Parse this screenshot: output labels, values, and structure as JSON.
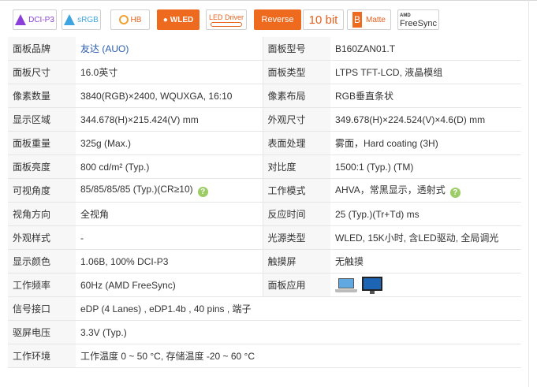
{
  "badges": {
    "dcip3": "DCI-P3",
    "srgb": "sRGB",
    "hb": "HB",
    "wled": "WLED",
    "led_driver": "LED Driver",
    "reverse": "Reverse",
    "bit": "10 bit",
    "matte_letter": "B",
    "matte": "Matte",
    "amd_small": "AMD",
    "freesync": "FreeSync"
  },
  "rows": [
    {
      "l1": "面板品牌",
      "v1": "友达 (AUO)",
      "l2": "面板型号",
      "v2": "B160ZAN01.T"
    },
    {
      "l1": "面板尺寸",
      "v1": "16.0英寸",
      "l2": "面板类型",
      "v2": "LTPS TFT-LCD, 液晶模组"
    },
    {
      "l1": "像素数量",
      "v1": "3840(RGB)×2400, WQUXGA, 16:10",
      "l2": "像素布局",
      "v2": "RGB垂直条状"
    },
    {
      "l1": "显示区域",
      "v1": "344.678(H)×215.424(V) mm",
      "l2": "外观尺寸",
      "v2": "349.678(H)×224.524(V)×4.6(D) mm"
    },
    {
      "l1": "面板重量",
      "v1": "325g (Max.)",
      "l2": "表面处理",
      "v2": "雾面，Hard coating (3H)"
    },
    {
      "l1": "面板亮度",
      "v1": "800 cd/m² (Typ.)",
      "l2": "对比度",
      "v2": "1500:1 (Typ.) (TM)"
    },
    {
      "l1": "可视角度",
      "v1": "85/85/85/85 (Typ.)(CR≥10)",
      "l2": "工作模式",
      "v2": "AHVA，常黑显示，透射式"
    },
    {
      "l1": "视角方向",
      "v1": "全视角",
      "l2": "反应时间",
      "v2": "25 (Typ.)(Tr+Td) ms"
    },
    {
      "l1": "外观样式",
      "v1": "-",
      "l2": "光源类型",
      "v2": "WLED, 15K小时, 含LED驱动, 全局调光"
    },
    {
      "l1": "显示颜色",
      "v1": "1.06B, 100% DCI-P3",
      "l2": "触摸屏",
      "v2": "无触摸"
    },
    {
      "l1": "工作频率",
      "v1": "60Hz  (AMD FreeSync)",
      "l2": "面板应用",
      "v2": ""
    }
  ],
  "wide_rows": [
    {
      "l": "信号接口",
      "v": "eDP (4 Lanes) , eDP1.4b , 40 pins , 端子"
    },
    {
      "l": "驱屏电压",
      "v": "3.3V (Typ.)"
    },
    {
      "l": "工作环境",
      "v": "工作温度 0 ~ 50 °C, 存储温度 -20 ~ 60 °C"
    }
  ],
  "help_glyph": "?",
  "icons": {
    "help": "question-circle-icon",
    "laptop": "laptop-icon",
    "monitor": "monitor-icon"
  },
  "colors": {
    "accent": "#ee6a1f",
    "help": "#9ccc65",
    "label_bg": "#f7f7f7"
  }
}
